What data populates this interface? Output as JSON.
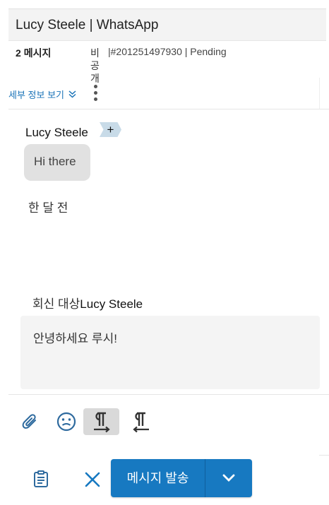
{
  "header": {
    "title": "Lucy Steele | WhatsApp"
  },
  "meta": {
    "message_count": "2",
    "message_word": "메시지",
    "privacy_chars": [
      "비",
      "공",
      "개"
    ],
    "ticket_line": "|#201251497930  |  Pending",
    "details_link": "세부 정보 보기"
  },
  "conversation": {
    "sender": "Lucy Steele",
    "add_tag_symbol": "+",
    "message": "Hi there",
    "timestamp": "한 달 전"
  },
  "reply": {
    "prefix": "회신 대상",
    "name": "Lucy Steele",
    "draft": "안녕하세요 루시!"
  },
  "toolbar": {
    "icons": [
      "paperclip-icon",
      "emoji-icon",
      "paragraph-ltr-icon",
      "paragraph-rtl-icon"
    ],
    "ltr_active": true
  },
  "actions": {
    "send_label": "메시지 발송",
    "colors": {
      "primary": "#1779c1",
      "link": "#1a73b8",
      "icon": "#2e6a9e"
    }
  }
}
